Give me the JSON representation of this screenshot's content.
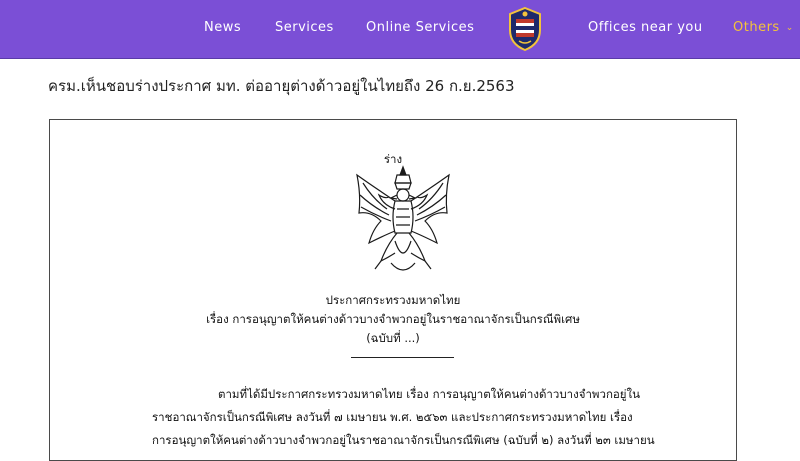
{
  "nav": {
    "items": [
      "News",
      "Services",
      "Online Services",
      "Offices near you"
    ],
    "others_label": "Others",
    "logo_icon": "police-emblem-icon"
  },
  "article": {
    "title": "ครม.เห็นชอบร่างประกาศ มท. ต่ออายุต่างด้าวอยู่ในไทยถึง 26 ก.ย.2563"
  },
  "document": {
    "draft_label": "ร่าง",
    "emblem_icon": "garuda-emblem-icon",
    "issuer": "ประกาศกระทรวงมหาดไทย",
    "subject": "เรื่อง  การอนุญาตให้คนต่างด้าวบางจำพวกอยู่ในราชอาณาจักรเป็นกรณีพิเศษ",
    "edition": "(ฉบับที่ ...)",
    "body_lines": [
      "ตามที่ได้มีประกาศกระทรวงมหาดไทย เรื่อง การอนุญาตให้คนต่างด้าวบางจำพวกอยู่ใน",
      "ราชอาณาจักรเป็นกรณีพิเศษ ลงวันที่ ๗ เมษายน พ.ศ. ๒๕๖๓ และประกาศกระทรวงมหาดไทย เรื่อง",
      "การอนุญาตให้คนต่างด้าวบางจำพวกอยู่ในราชอาณาจักรเป็นกรณีพิเศษ (ฉบับที่ ๒) ลงวันที่ ๒๓ เมษายน"
    ]
  },
  "colors": {
    "navbar": "#7b4fd6",
    "nav_text": "#ffffff",
    "nav_accent": "#f3c33c"
  }
}
